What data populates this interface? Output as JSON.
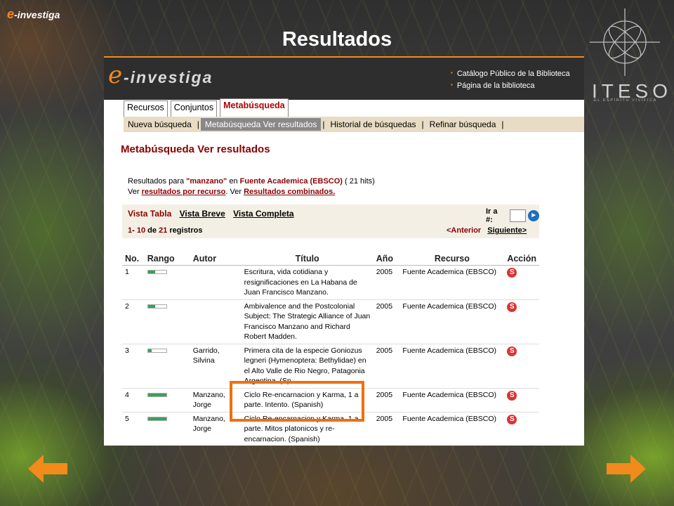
{
  "slide": {
    "brand_e": "e",
    "brand_rest": "-investiga",
    "title": "Resultados",
    "logo_text": "ITESO",
    "logo_subtitle": "EL ESPÍRITU VIVIFICA",
    "arrow_color": "#f28a1c"
  },
  "app": {
    "logo_e": "e",
    "logo_rest": "-investiga",
    "header_links": [
      "Catálogo Público de la Biblioteca",
      "Página de la biblioteca"
    ],
    "tabs": [
      {
        "label": "Recursos",
        "active": false
      },
      {
        "label": "Conjuntos",
        "active": false
      },
      {
        "label": "Metabúsqueda",
        "active": true
      }
    ],
    "subnav": [
      {
        "label": "Nueva búsqueda",
        "active": false
      },
      {
        "label": "Metabúsqueda Ver resultados",
        "active": true
      },
      {
        "label": "Historial de búsquedas",
        "active": false
      },
      {
        "label": "Refinar búsqueda",
        "active": false
      }
    ],
    "page_heading": "Metabúsqueda Ver resultados",
    "results_line": {
      "prefix": "Resultados para",
      "query": "\"manzano\"",
      "en": "en",
      "source": "Fuente Academica (EBSCO)",
      "hits": "( 21 hits)"
    },
    "view_line": {
      "ver1": "Ver",
      "link1": "resultados por recurso",
      "ver2": ". Ver",
      "link2": "Resultados combinados."
    },
    "view_tabs": {
      "table": "Vista Tabla",
      "brief": "Vista Breve",
      "full": "Vista Completa"
    },
    "goto_label": "Ir a #:",
    "range": {
      "start": "1",
      "dash": "-",
      "end": "10",
      "de": "de",
      "total": "21",
      "suffix": "registros"
    },
    "pager": {
      "prev": "<Anterior",
      "next": "Siguiente>"
    },
    "columns": [
      "No.",
      "Rango",
      "Autor",
      "Título",
      "Año",
      "Recurso",
      "Acción"
    ],
    "rows": [
      {
        "no": "1",
        "rank": 0.4,
        "author": "",
        "title": "Escritura, vida cotidiana y resignificaciones en La Habana de Juan Francisco Manzano.",
        "year": "2005",
        "resource": "Fuente Academica (EBSCO)"
      },
      {
        "no": "2",
        "rank": 0.4,
        "author": "",
        "title": "Ambivalence and the Postcolonial Subject: The Strategic Alliance of Juan Francisco Manzano and Richard Robert Madden.",
        "year": "2005",
        "resource": "Fuente Academica (EBSCO)"
      },
      {
        "no": "3",
        "rank": 0.2,
        "author": "Garrido, Silvina",
        "title": "Primera cita de la especie Goniozus legneri (Hymenoptera: Bethylidae) en el Alto Valle de Rio Negro, Patagonia Argentina. (Sp…",
        "year": "2005",
        "resource": "Fuente Academica (EBSCO)"
      },
      {
        "no": "4",
        "rank": 1.0,
        "author": "Manzano, Jorge",
        "title": "Ciclo Re-encarnacion y Karma, 1 a parte. Intento. (Spanish)",
        "year": "2005",
        "resource": "Fuente Academica (EBSCO)"
      },
      {
        "no": "5",
        "rank": 1.0,
        "author": "Manzano, Jorge",
        "title": "Ciclo Re-encarnacion y Karma, 1 a parte. Mitos platonicos y re-encarnacion. (Spanish)",
        "year": "2005",
        "resource": "Fuente Academica (EBSCO)"
      }
    ],
    "action_icon": "fulltext-link-icon"
  }
}
